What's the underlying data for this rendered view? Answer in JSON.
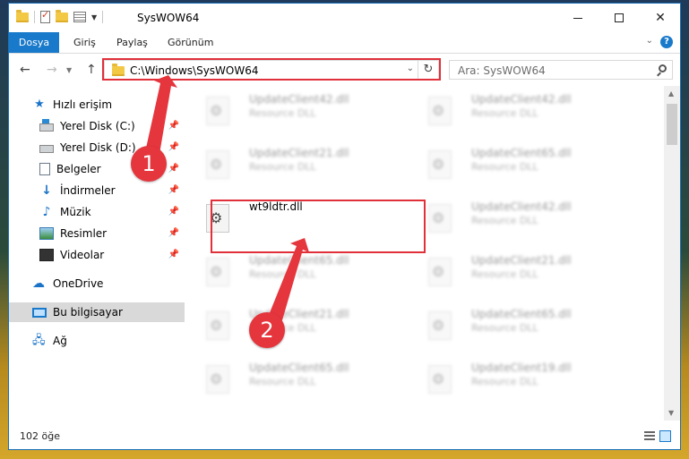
{
  "window": {
    "title": "SysWOW64"
  },
  "ribbon": {
    "tabs": [
      "Dosya",
      "Giriş",
      "Paylaş",
      "Görünüm"
    ]
  },
  "address": {
    "path": "C:\\Windows\\SysWOW64"
  },
  "search": {
    "placeholder": "Ara: SysWOW64"
  },
  "sidebar": {
    "items": [
      {
        "label": "Hızlı erişim",
        "icon": "star-icon"
      },
      {
        "label": "Yerel Disk (C:)",
        "icon": "drive-icon",
        "pinned": true
      },
      {
        "label": "Yerel Disk (D:)",
        "icon": "drive-icon",
        "pinned": true
      },
      {
        "label": "Belgeler",
        "icon": "documents-icon",
        "pinned": true
      },
      {
        "label": "İndirmeler",
        "icon": "download-icon",
        "pinned": true
      },
      {
        "label": "Müzik",
        "icon": "music-icon",
        "pinned": true
      },
      {
        "label": "Resimler",
        "icon": "pictures-icon",
        "pinned": true
      },
      {
        "label": "Videolar",
        "icon": "videos-icon",
        "pinned": true
      },
      {
        "label": "OneDrive",
        "icon": "cloud-icon"
      },
      {
        "label": "Bu bilgisayar",
        "icon": "computer-icon",
        "selected": true
      },
      {
        "label": "Ağ",
        "icon": "network-icon"
      }
    ]
  },
  "files": [
    {
      "name": "UpdateClient42.dll",
      "type": "Resource DLL"
    },
    {
      "name": "UpdateClient42.dll",
      "type": "Resource DLL"
    },
    {
      "name": "UpdateClient21.dll",
      "type": "Resource DLL"
    },
    {
      "name": "UpdateClient65.dll",
      "type": "Resource DLL"
    },
    {
      "name": "wt9ldtr.dll",
      "type": ""
    },
    {
      "name": "UpdateClient42.dll",
      "type": "Resource DLL"
    },
    {
      "name": "UpdateClient65.dll",
      "type": "Resource DLL"
    },
    {
      "name": "UpdateClient21.dll",
      "type": "Resource DLL"
    },
    {
      "name": "UpdateClient21.dll",
      "type": "Resource DLL"
    },
    {
      "name": "UpdateClient65.dll",
      "type": "Resource DLL"
    },
    {
      "name": "UpdateClient65.dll",
      "type": "Resource DLL"
    },
    {
      "name": "UpdateClient19.dll",
      "type": "Resource DLL"
    }
  ],
  "status": {
    "count": "102 öğe"
  },
  "annotations": {
    "badge1": "1",
    "badge2": "2",
    "color": "#e5353d"
  }
}
